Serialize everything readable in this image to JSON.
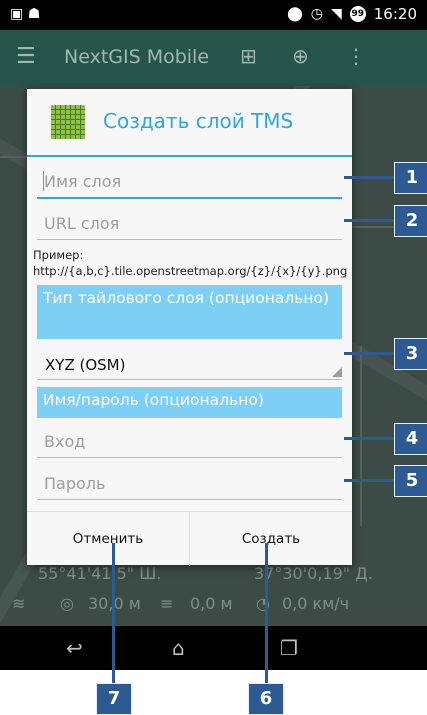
{
  "status_bar": {
    "left_icons": [
      "image-icon",
      "android-icon"
    ],
    "time": "16:20",
    "battery_level": "99"
  },
  "app_bar": {
    "title": "NextGIS Mobile"
  },
  "map": {
    "latitude": "55°41'41.5\" Ш.",
    "longitude": "37°30'0,19\" Д.",
    "accuracy": "30,0 м",
    "altitude": "0,0 м",
    "speed": "0,0 км/ч"
  },
  "dialog": {
    "title": "Создать слой TMS",
    "layer_name_placeholder": "Имя слоя",
    "layer_url_placeholder": "URL слоя",
    "example_text": "Пример: http://{a,b,c}.tile.openstreetmap.org/{z}/{x}/{y}.png",
    "tile_type_header": "Тип тайлового слоя (опционально)",
    "tile_type_value": "XYZ (OSM)",
    "auth_header": "Имя/пароль (опционально)",
    "login_placeholder": "Вход",
    "password_placeholder": "Пароль",
    "cancel_label": "Отменить",
    "create_label": "Создать"
  },
  "callouts": [
    "1",
    "2",
    "3",
    "4",
    "5",
    "6",
    "7"
  ],
  "colors": {
    "accent": "#2fa7d8",
    "section_bg": "#7dcff5",
    "callout": "#2e5a93",
    "app_bar": "#25544a"
  }
}
